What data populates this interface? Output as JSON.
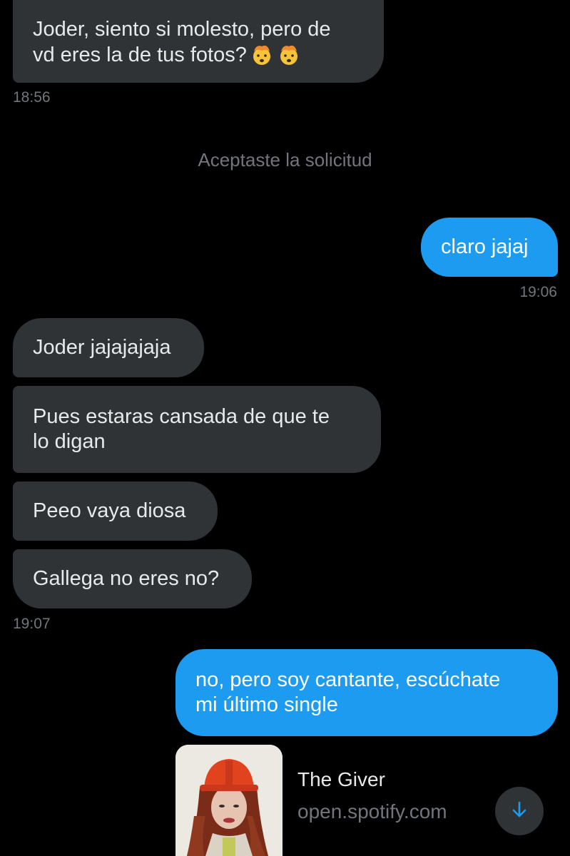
{
  "messages": [
    {
      "text": "Joder, siento si molesto, pero de\nvd eres la de tus fotos?",
      "emoji": "exploding-head-icon"
    },
    {
      "text": "claro jajaj"
    },
    {
      "text": "Joder jajajajaja"
    },
    {
      "text": "Pues estaras cansada de que te\nlo digan"
    },
    {
      "text": "Peeo vaya diosa"
    },
    {
      "text": "Gallega no eres no?"
    },
    {
      "text": "no, pero soy cantante, escúchate\nmi último single"
    }
  ],
  "timestamps": [
    "18:56",
    "19:06",
    "19:07"
  ],
  "system_message": "Aceptaste la solicitud",
  "link_card": {
    "title": "The Giver",
    "domain": "open.spotify.com",
    "icon": "arrow-down-icon"
  },
  "colors": {
    "background": "#000000",
    "incoming_bubble": "#2f3336",
    "outgoing_bubble": "#1d9bf0",
    "muted_text": "#71767b",
    "accent": "#1d9bf0"
  }
}
